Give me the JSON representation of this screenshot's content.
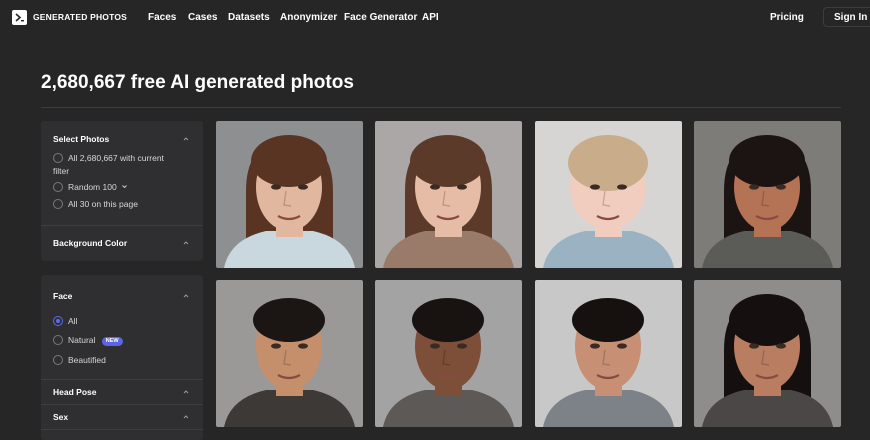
{
  "header": {
    "brand": "GENERATED PHOTOS",
    "nav": [
      "Faces",
      "Cases",
      "Datasets",
      "Anonymizer",
      "Face Generator",
      "API"
    ],
    "pricing": "Pricing",
    "sign_in": "Sign In"
  },
  "page": {
    "title": "2,680,667 free AI generated photos"
  },
  "sidebar": {
    "select_photos": {
      "title": "Select Photos",
      "options": [
        "All 2,680,667 with current",
        "filter",
        "Random 100",
        "All 30 on this page"
      ]
    },
    "background_color": {
      "title": "Background Color"
    },
    "face": {
      "title": "Face",
      "options": [
        "All",
        "Natural",
        "Beautified"
      ],
      "badge": "NEW"
    },
    "head_pose": {
      "title": "Head Pose"
    },
    "sex": {
      "title": "Sex"
    }
  },
  "photos": [
    {
      "bg": "#8e8f90",
      "skin": "#e2b7a0",
      "hair": "#5a3423",
      "shirt": "#c9d7df",
      "icon": "woman-face-portrait"
    },
    {
      "bg": "#aaa7a6",
      "skin": "#e7bca7",
      "hair": "#5b3a2a",
      "shirt": "#9a7b6a",
      "icon": "woman-face-portrait"
    },
    {
      "bg": "#d6d5d4",
      "skin": "#f1cdbf",
      "hair": "#c9ad8a",
      "shirt": "#9bb2c2",
      "icon": "child-face-portrait"
    },
    {
      "bg": "#7e7c78",
      "skin": "#b57355",
      "hair": "#1c1413",
      "shirt": "#5b5b58",
      "icon": "woman-face-portrait"
    },
    {
      "bg": "#9a9998",
      "skin": "#c58f6c",
      "hair": "#1b1614",
      "shirt": "#3d3937",
      "icon": "man-face-portrait"
    },
    {
      "bg": "#a4a3a3",
      "skin": "#7d4e38",
      "hair": "#181211",
      "shirt": "#5c5957",
      "icon": "man-face-portrait"
    },
    {
      "bg": "#c9c8c8",
      "skin": "#c79074",
      "hair": "#16110f",
      "shirt": "#7c8287",
      "icon": "man-face-portrait"
    },
    {
      "bg": "#8f8d8b",
      "skin": "#b97e62",
      "hair": "#15100f",
      "shirt": "#4b4746",
      "icon": "woman-face-portrait"
    }
  ]
}
